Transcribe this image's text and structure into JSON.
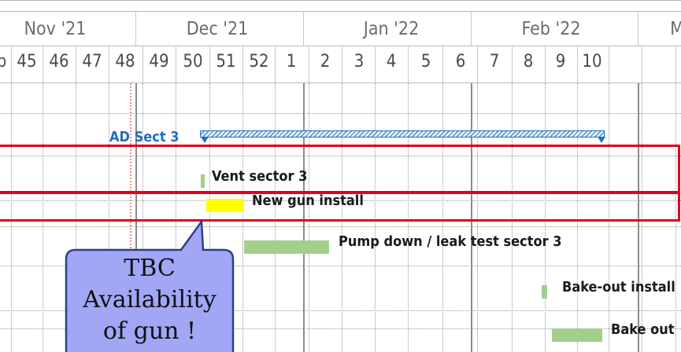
{
  "timeline": {
    "months": [
      {
        "label": "Nov '21"
      },
      {
        "label": "Dec '21"
      },
      {
        "label": "Jan '22"
      },
      {
        "label": "Feb '22"
      },
      {
        "label": "M"
      }
    ],
    "weeks": [
      "p",
      "45",
      "46",
      "47",
      "48",
      "49",
      "50",
      "51",
      "52",
      "1",
      "2",
      "3",
      "4",
      "5",
      "6",
      "7",
      "8",
      "9",
      "10"
    ]
  },
  "summary_task": {
    "label": "AD Sect 3",
    "color": "#1f6fbf"
  },
  "tasks": [
    {
      "label": "Vent sector 3"
    },
    {
      "label": "New gun install",
      "bar_color": "#ffff00"
    },
    {
      "label": "Pump down / leak test sector 3"
    },
    {
      "label": "Bake-out install"
    },
    {
      "label": "Bake out"
    }
  ],
  "callout": {
    "text_lines": [
      "TBC",
      "Availability",
      "of gun !"
    ],
    "fill": "#a1a7f5",
    "stroke": "#2f3f86"
  },
  "colors": {
    "highlight_border": "#e3001b",
    "task_bar_green": "#a3cf8c",
    "milestone_yellow": "#ffff00"
  }
}
